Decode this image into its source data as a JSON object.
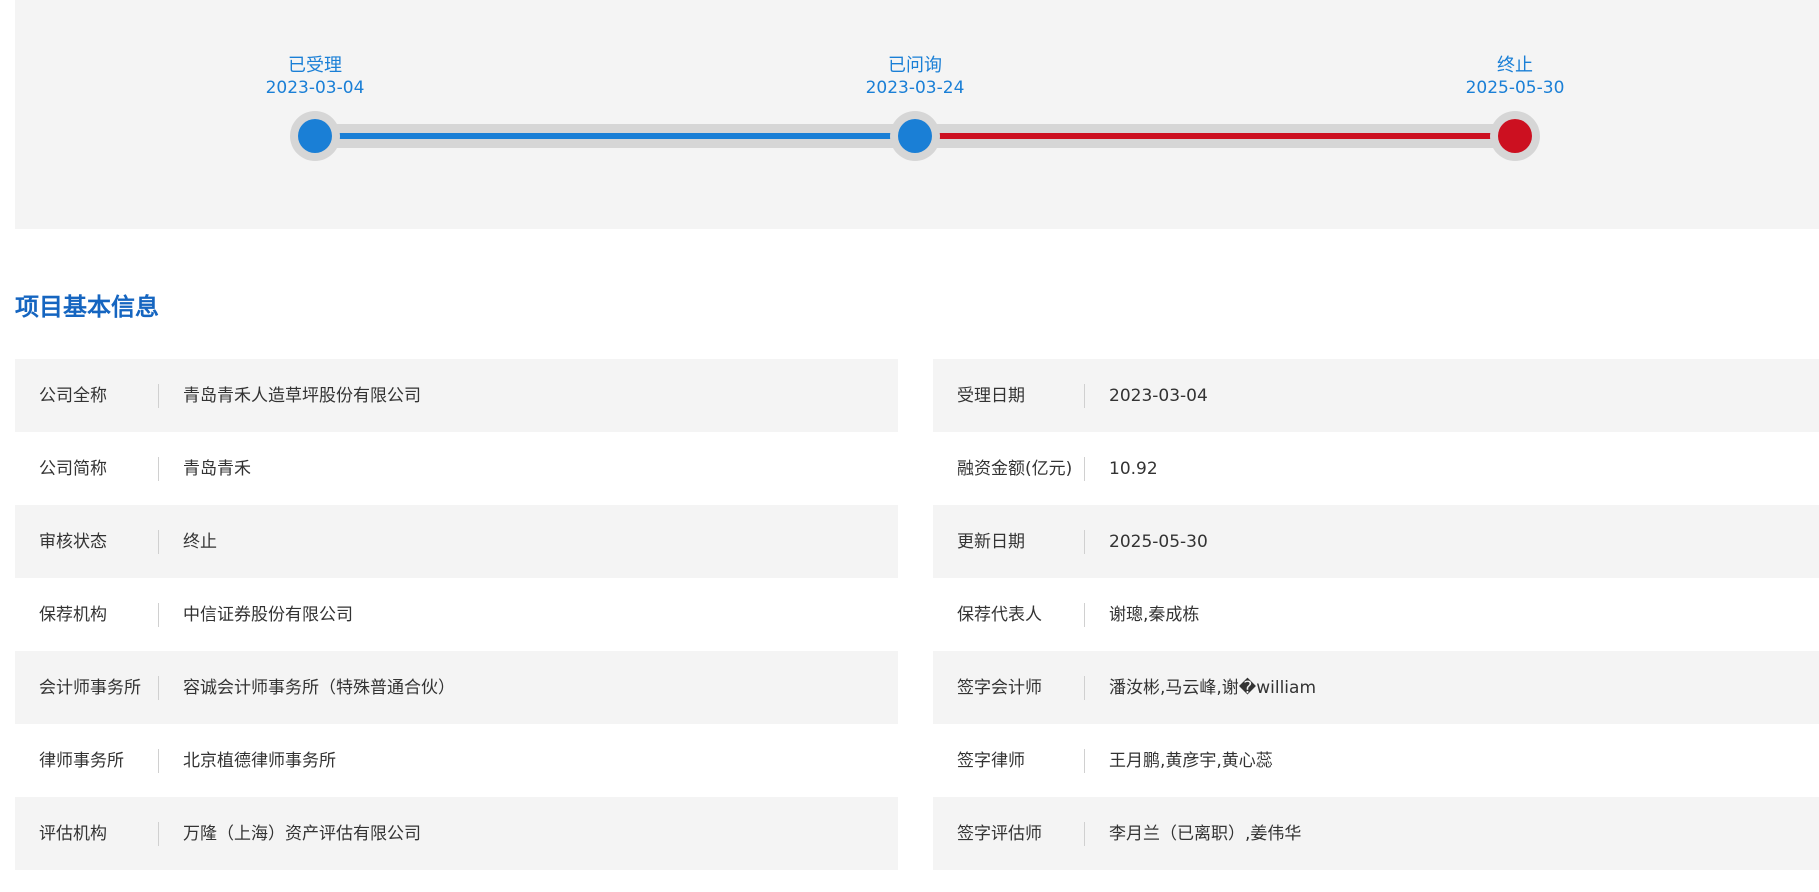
{
  "timeline": {
    "steps": [
      {
        "name": "已受理",
        "date": "2023-03-04",
        "color": "#1a7fd6"
      },
      {
        "name": "已问询",
        "date": "2023-03-24",
        "color": "#1a7fd6"
      },
      {
        "name": "终止",
        "date": "2025-05-30",
        "color": "#cc1020"
      }
    ],
    "colors": {
      "active": "#1a7fd6",
      "terminated": "#cc1020",
      "track": "#d6d6d6"
    }
  },
  "section": {
    "title": "项目基本信息"
  },
  "info": {
    "left": [
      {
        "key": "公司全称",
        "value": "青岛青禾人造草坪股份有限公司"
      },
      {
        "key": "公司简称",
        "value": "青岛青禾"
      },
      {
        "key": "审核状态",
        "value": "终止"
      },
      {
        "key": "保荐机构",
        "value": "中信证券股份有限公司"
      },
      {
        "key": "会计师事务所",
        "value": "容诚会计师事务所（特殊普通合伙）"
      },
      {
        "key": "律师事务所",
        "value": "北京植德律师事务所"
      },
      {
        "key": "评估机构",
        "value": "万隆（上海）资产评估有限公司"
      }
    ],
    "right": [
      {
        "key": "受理日期",
        "value": "2023-03-04"
      },
      {
        "key": "融资金额(亿元)",
        "value": "10.92"
      },
      {
        "key": "更新日期",
        "value": "2025-05-30"
      },
      {
        "key": "保荐代表人",
        "value": "谢璁,秦成栋"
      },
      {
        "key": "签字会计师",
        "value": "潘汝彬,马云峰,谢�william"
      },
      {
        "key": "签字律师",
        "value": "王月鹏,黄彦宇,黄心蕊"
      },
      {
        "key": "签字评估师",
        "value": "李月兰（已离职）,姜伟华"
      }
    ]
  }
}
